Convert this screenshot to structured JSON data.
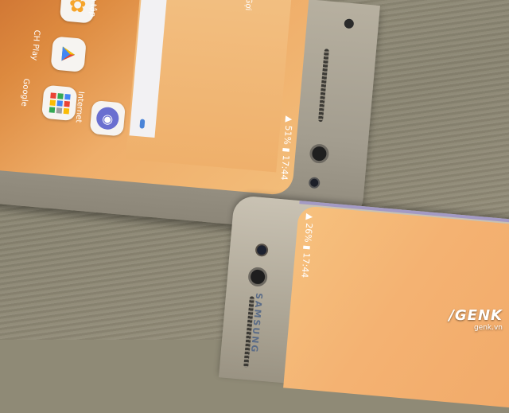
{
  "phone_top": {
    "apps": [
      {
        "label": "sửu tập",
        "icon": "flower-icon"
      },
      {
        "label": "CH Play",
        "icon": "play-store-icon"
      },
      {
        "label": "Google",
        "icon": "google-folder-icon"
      },
      {
        "label": "Internet",
        "icon": "internet-icon"
      }
    ],
    "search_text": "Gợi",
    "status": "▲ 51% ▮ 17:44"
  },
  "phone_bottom": {
    "status": "▲ 26% ▮ 17:44",
    "brand": "SAMSUNG"
  },
  "watermark": {
    "logo": "/GENK",
    "site": "genk.vn"
  },
  "colors": {
    "screen_orange": "#efae6a",
    "frame_silver": "#b7b0a0",
    "table": "#8f8a76"
  }
}
